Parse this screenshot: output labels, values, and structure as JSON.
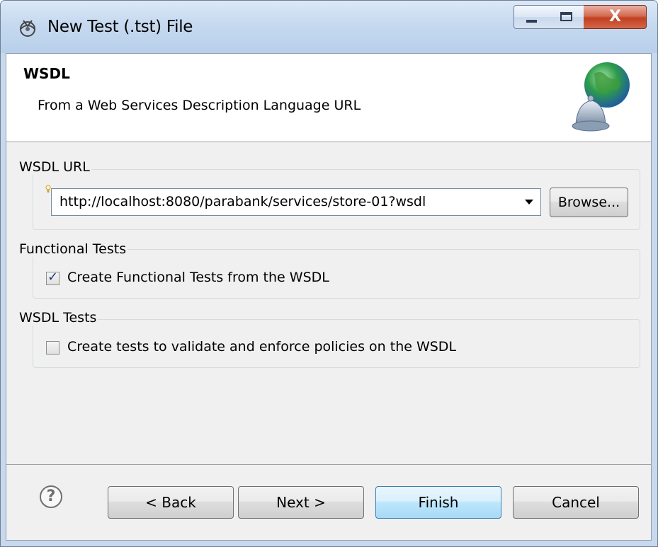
{
  "window": {
    "title": "New Test (.tst) File",
    "controls": {
      "minimize_icon": "minimize-icon",
      "maximize_icon": "maximize-icon",
      "close_glyph": "X"
    }
  },
  "header": {
    "title": "WSDL",
    "description": "From a Web Services Description Language URL",
    "icon": "globe-bell-icon"
  },
  "wsdl_url": {
    "label": "WSDL URL",
    "value": "http://localhost:8080/parabank/services/store-01?wsdl",
    "browse_label": "Browse..."
  },
  "functional_tests": {
    "label": "Functional Tests",
    "checkbox_label": "Create Functional Tests from the WSDL",
    "checked": true
  },
  "wsdl_tests": {
    "label": "WSDL Tests",
    "checkbox_label": "Create tests to validate and enforce policies on the WSDL",
    "checked": false
  },
  "footer": {
    "help_glyph": "?",
    "back_label": "< Back",
    "next_label": "Next >",
    "finish_label": "Finish",
    "cancel_label": "Cancel"
  },
  "colors": {
    "titlebar": "#c6d9f0",
    "dialog_bg": "#f0f0f0",
    "finish_focus": "#3c7fb1",
    "close_red": "#c2401f"
  }
}
